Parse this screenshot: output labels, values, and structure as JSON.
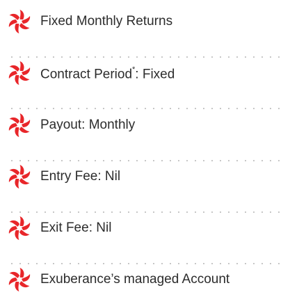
{
  "features": [
    {
      "label": "Fixed Monthly Returns",
      "icon": "star-burst-icon"
    },
    {
      "label_pre": "Contract Period",
      "label_sup": "*",
      "label_post": ": Fixed",
      "icon": "star-burst-icon"
    },
    {
      "label": "Payout: Monthly",
      "icon": "star-burst-icon"
    },
    {
      "label": "Entry Fee: Nil",
      "icon": "star-burst-icon"
    },
    {
      "label": "Exit Fee: Nil",
      "icon": "star-burst-icon"
    },
    {
      "label": "Exuberance’s managed Account",
      "icon": "star-burst-icon"
    }
  ],
  "colors": {
    "icon": "#e8262a",
    "text": "#2c2c2c",
    "divider": "#b9b9b9"
  }
}
